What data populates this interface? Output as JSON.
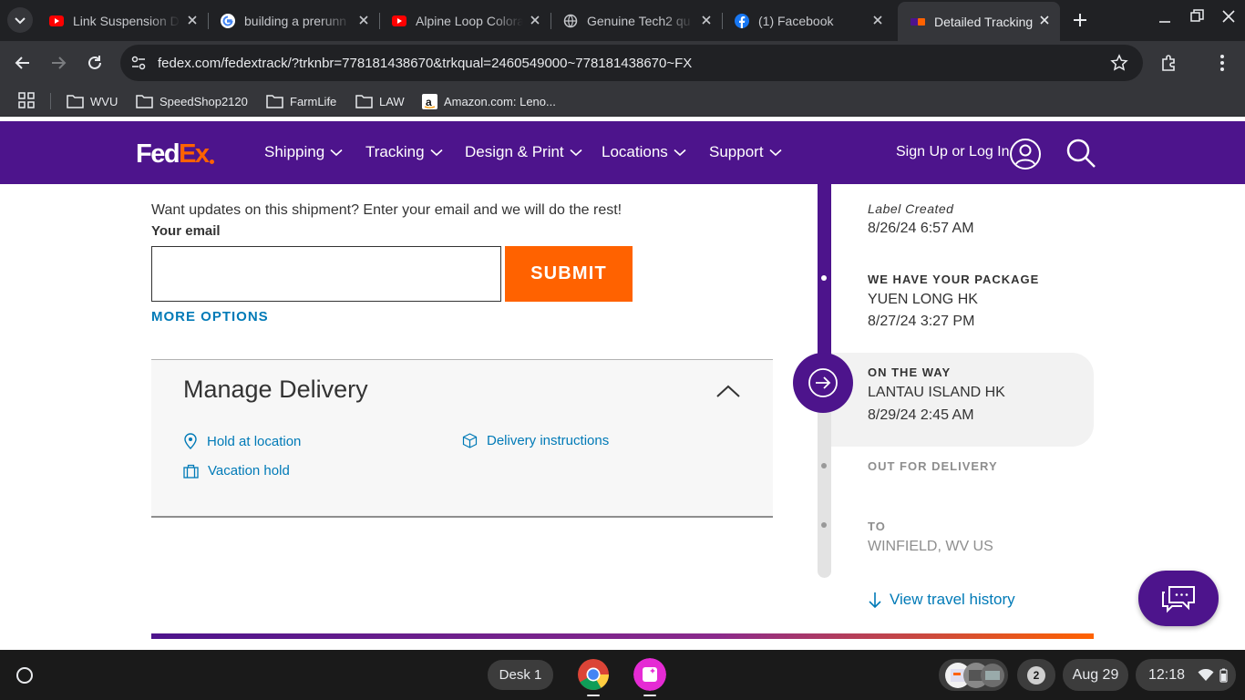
{
  "browser": {
    "tabs": [
      {
        "title": "Link Suspension D",
        "favicon": "youtube-icon"
      },
      {
        "title": "building a prerunn",
        "favicon": "google-icon"
      },
      {
        "title": "Alpine Loop Colora",
        "favicon": "youtube-icon"
      },
      {
        "title": "Genuine Tech2 qu",
        "favicon": "globe-icon"
      },
      {
        "title": "(1) Facebook",
        "favicon": "facebook-icon"
      },
      {
        "title": "Detailed Tracking",
        "favicon": "fedex-icon",
        "active": true
      }
    ],
    "url": "fedex.com/fedextrack/?trknbr=778181438670&trkqual=2460549000~778181438670~FX",
    "bookmarks": [
      {
        "label": "WVU",
        "icon": "folder-icon"
      },
      {
        "label": "SpeedShop2120",
        "icon": "folder-icon"
      },
      {
        "label": "FarmLife",
        "icon": "folder-icon"
      },
      {
        "label": "LAW",
        "icon": "folder-icon"
      },
      {
        "label": "Amazon.com: Leno...",
        "icon": "amazon-icon"
      }
    ]
  },
  "fedex": {
    "logo": {
      "fed": "Fed",
      "ex": "Ex"
    },
    "nav": [
      {
        "label": "Shipping"
      },
      {
        "label": "Tracking"
      },
      {
        "label": "Design & Print"
      },
      {
        "label": "Locations"
      },
      {
        "label": "Support"
      }
    ],
    "login_label": "Sign Up or Log In",
    "colors": {
      "purple": "#4d148c",
      "orange": "#ff6200",
      "link": "#007ab7"
    }
  },
  "updates": {
    "prompt": "Want updates on this shipment? Enter your email and we will do the rest!",
    "email_label": "Your email",
    "email_value": "",
    "submit_label": "SUBMIT",
    "more_options": "MORE OPTIONS"
  },
  "manage_delivery": {
    "title": "Manage Delivery",
    "links": [
      {
        "label": "Hold at location",
        "icon": "location-pin-icon"
      },
      {
        "label": "Delivery instructions",
        "icon": "package-icon"
      },
      {
        "label": "Vacation hold",
        "icon": "suitcase-icon"
      }
    ]
  },
  "tracking": {
    "events": [
      {
        "status": "Label Created",
        "location": "",
        "datetime": "8/26/24 6:57 AM"
      },
      {
        "status": "WE HAVE YOUR PACKAGE",
        "location": "YUEN LONG HK",
        "datetime": "8/27/24 3:27 PM"
      },
      {
        "status": "ON THE WAY",
        "location": "LANTAU ISLAND HK",
        "datetime": "8/29/24 2:45 AM",
        "current": true
      },
      {
        "status": "OUT FOR DELIVERY",
        "location": "",
        "datetime": ""
      },
      {
        "status": "TO",
        "location": "WINFIELD, WV US",
        "datetime": ""
      }
    ],
    "view_history": "View travel history"
  },
  "taskbar": {
    "desk_label": "Desk 1",
    "notifications": "2",
    "date": "Aug 29",
    "time": "12:18"
  }
}
